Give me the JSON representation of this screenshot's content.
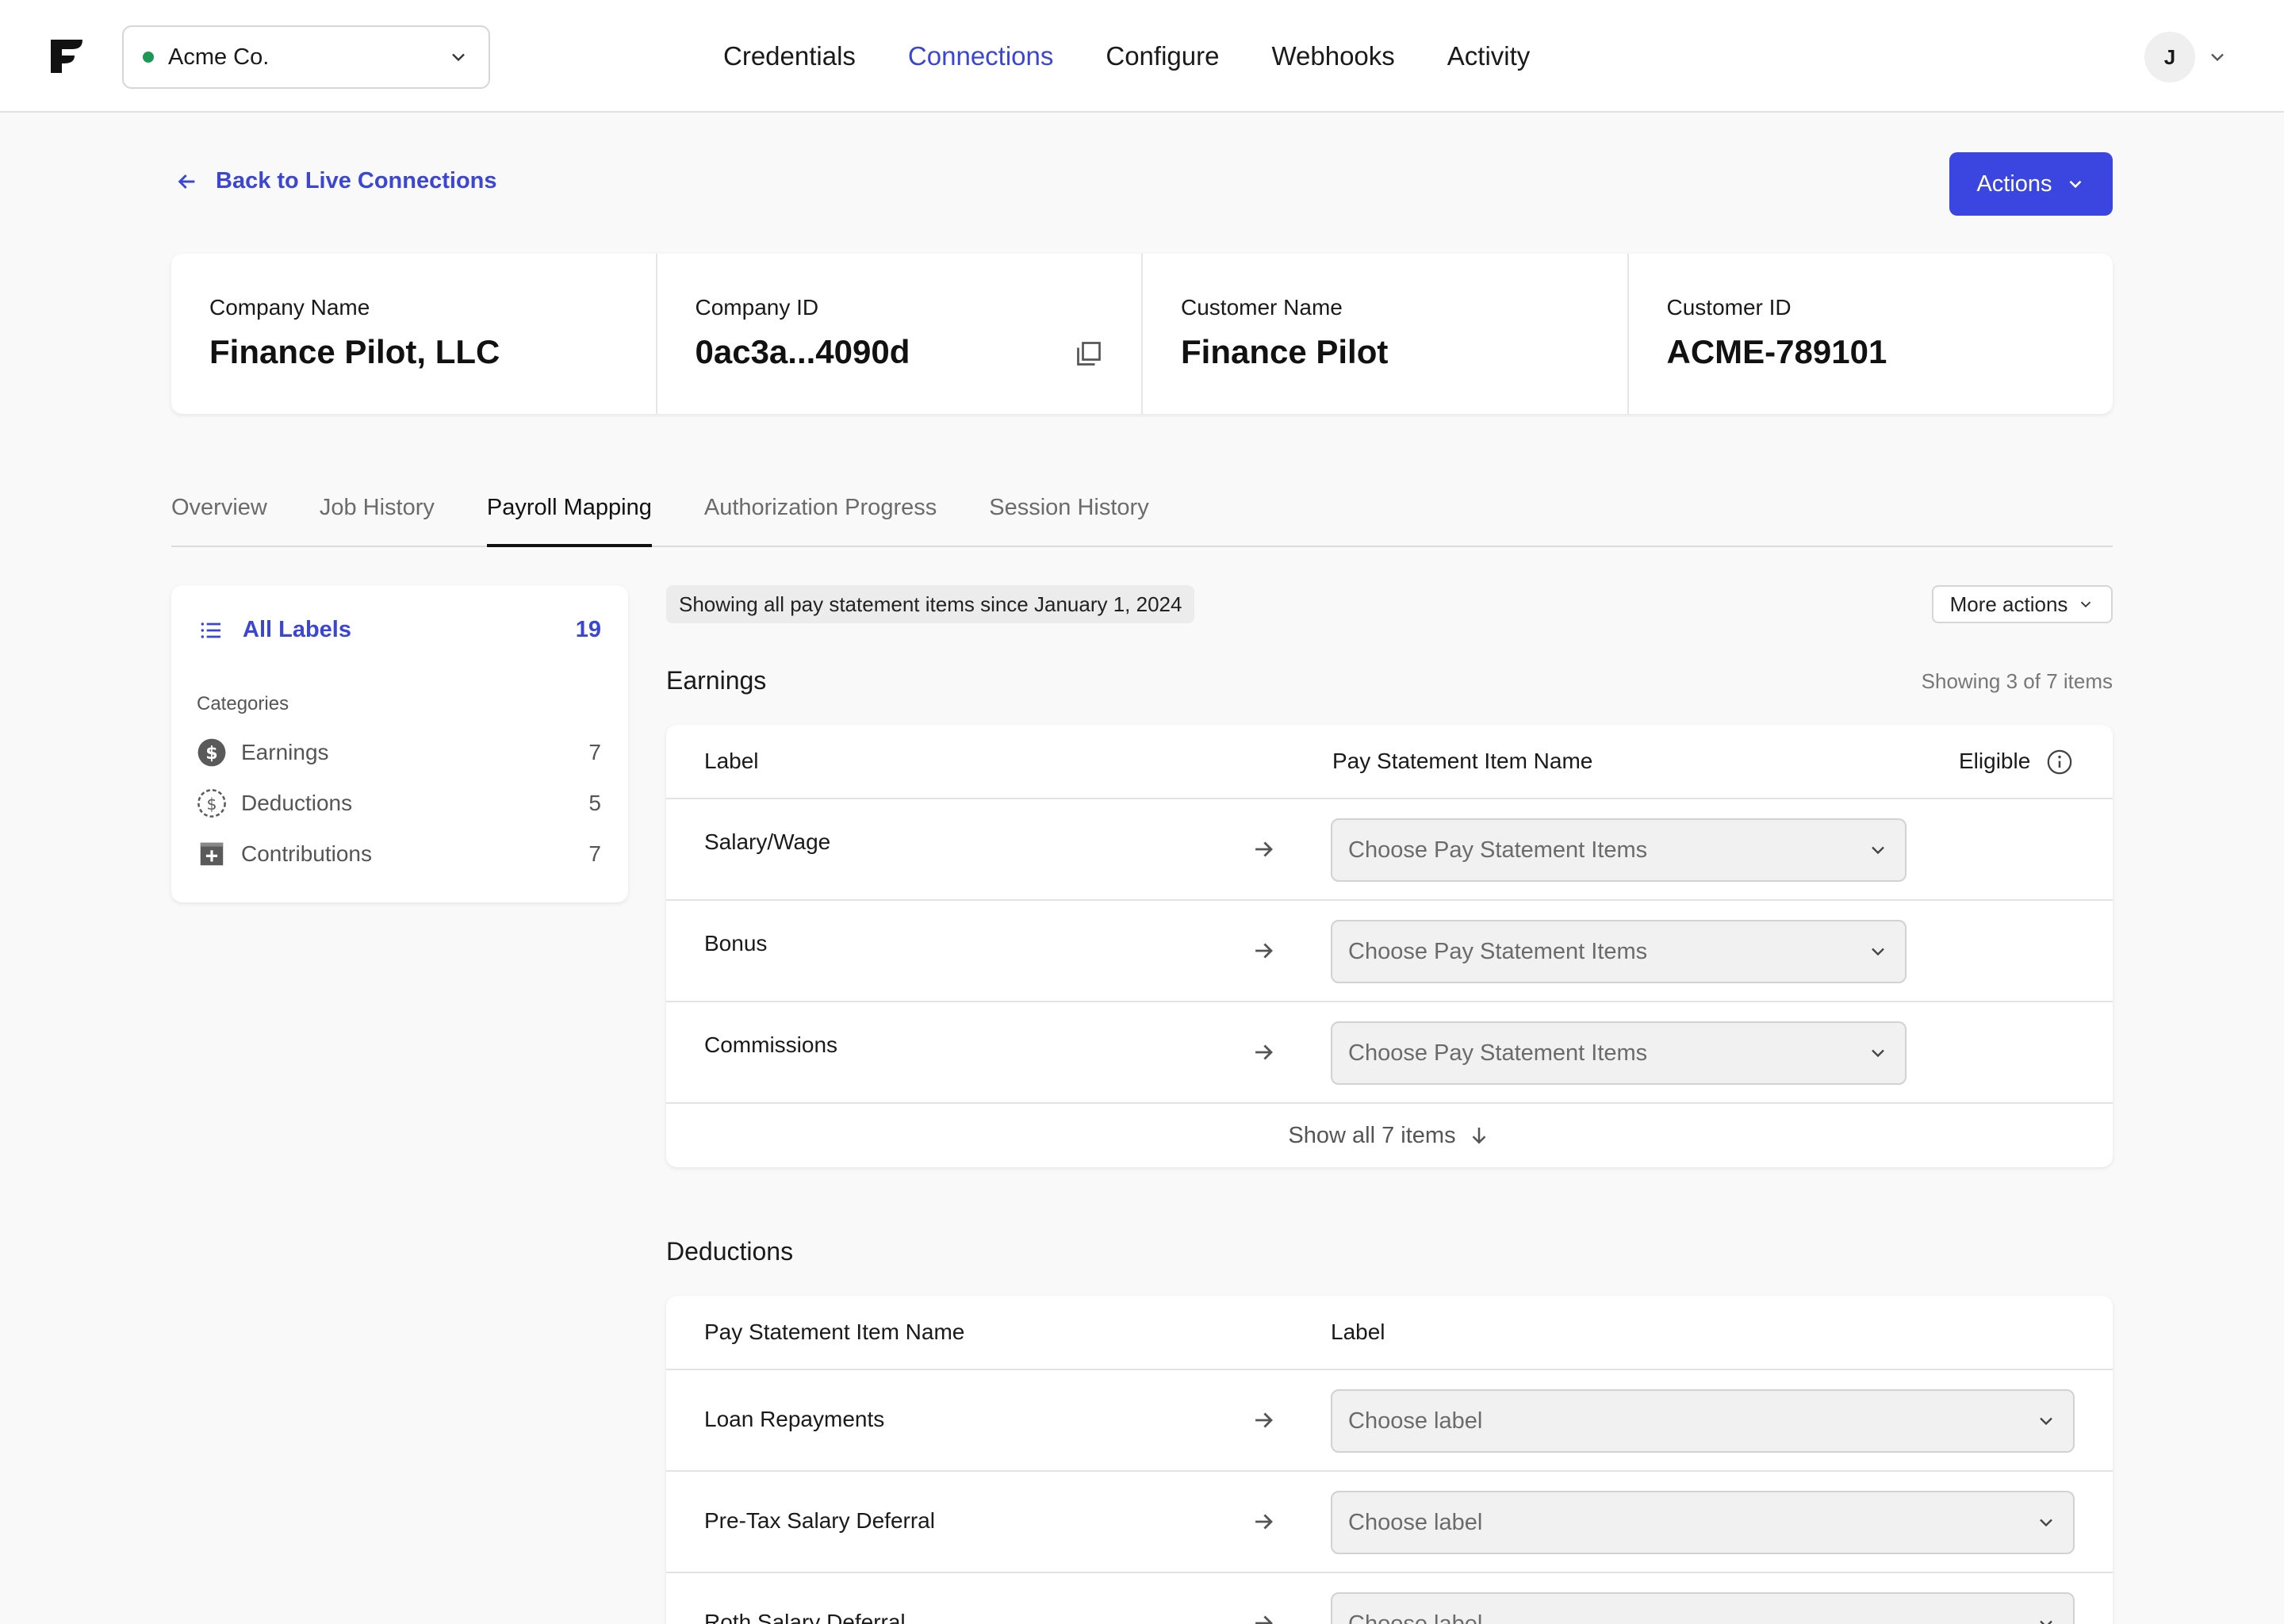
{
  "topbar": {
    "org_name": "Acme Co.",
    "nav": [
      {
        "label": "Credentials",
        "active": false
      },
      {
        "label": "Connections",
        "active": true
      },
      {
        "label": "Configure",
        "active": false
      },
      {
        "label": "Webhooks",
        "active": false
      },
      {
        "label": "Activity",
        "active": false
      }
    ],
    "avatar_initial": "J"
  },
  "back_link": "Back to Live Connections",
  "actions_label": "Actions",
  "info": [
    {
      "label": "Company Name",
      "value": "Finance Pilot, LLC"
    },
    {
      "label": "Company ID",
      "value": "0ac3a...4090d"
    },
    {
      "label": "Customer Name",
      "value": "Finance Pilot"
    },
    {
      "label": "Customer ID",
      "value": "ACME-789101"
    }
  ],
  "tabs": [
    {
      "label": "Overview",
      "active": false
    },
    {
      "label": "Job History",
      "active": false
    },
    {
      "label": "Payroll Mapping",
      "active": true
    },
    {
      "label": "Authorization Progress",
      "active": false
    },
    {
      "label": "Session History",
      "active": false
    }
  ],
  "sidebar": {
    "all_labels": "All Labels",
    "all_count": "19",
    "categories_title": "Categories",
    "categories": [
      {
        "label": "Earnings",
        "count": "7",
        "icon": "dollar-filled-icon"
      },
      {
        "label": "Deductions",
        "count": "5",
        "icon": "dollar-dashed-icon"
      },
      {
        "label": "Contributions",
        "count": "7",
        "icon": "plus-square-icon"
      }
    ]
  },
  "filter_text": "Showing all pay statement items since January 1, 2024",
  "more_actions": "More actions",
  "earnings": {
    "title": "Earnings",
    "meta": "Showing 3 of 7 items",
    "col_label": "Label",
    "col_item": "Pay Statement Item Name",
    "col_eligible": "Eligible",
    "rows": [
      {
        "label": "Salary/Wage",
        "placeholder": "Choose Pay Statement Items"
      },
      {
        "label": "Bonus",
        "placeholder": "Choose Pay Statement Items"
      },
      {
        "label": "Commissions",
        "placeholder": "Choose Pay Statement Items"
      }
    ],
    "show_all": "Show all 7 items"
  },
  "deductions": {
    "title": "Deductions",
    "col_item": "Pay Statement Item Name",
    "col_label": "Label",
    "rows": [
      {
        "label": "Loan Repayments",
        "placeholder": "Choose label"
      },
      {
        "label": "Pre-Tax Salary Deferral",
        "placeholder": "Choose label"
      },
      {
        "label": "Roth Salary Deferral",
        "placeholder": "Choose label"
      }
    ]
  },
  "colors": {
    "accent": "#3b46d6",
    "status_green": "#1c9a55"
  }
}
